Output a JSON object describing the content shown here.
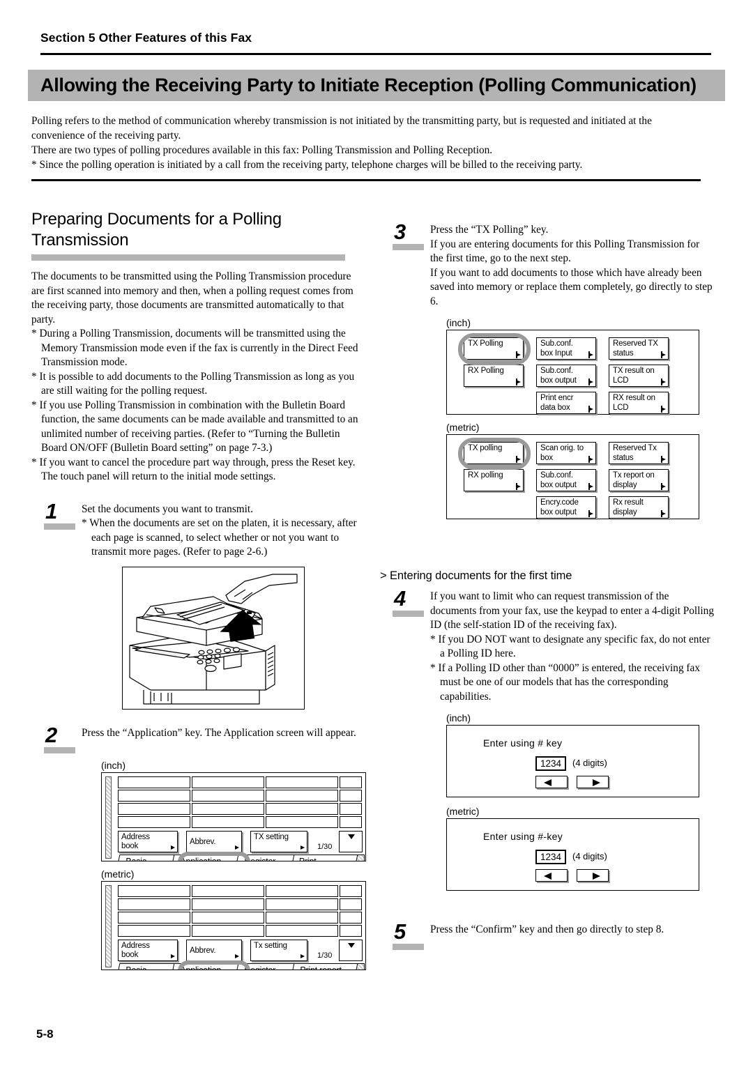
{
  "header": {
    "section": "Section 5  Other Features of this Fax",
    "title": "Allowing the Receiving Party to Initiate Reception  (Polling Communication)"
  },
  "intro": {
    "line1": "Polling refers to the method of communication whereby transmission is not initiated by the transmitting party, but is requested and initiated at the convenience of the receiving party.",
    "line2": "There are two types of polling procedures available in this fax: Polling Transmission and Polling Reception.",
    "line3": "* Since the polling operation is initiated by a call from the receiving party, telephone charges will be billed to the receiving party."
  },
  "left": {
    "heading": "Preparing Documents for a Polling Transmission",
    "body": {
      "para1": "The documents to be transmitted using the Polling Transmission procedure are first scanned into memory and then, when a polling request comes from the receiving party, those documents are transmitted automatically to that party.",
      "bullet1": "* During a Polling Transmission, documents will be transmitted using the Memory Transmission mode even if the fax is currently in the Direct Feed Transmission mode.",
      "bullet2": "* It is possible to add documents to the Polling Transmission as long as you are still waiting for the polling request.",
      "bullet3": "* If you use Polling Transmission in combination with the Bulletin Board function, the same documents can be made available and transmitted to an unlimited number of receiving parties. (Refer to “Turning the Bulletin Board ON/OFF (Bulletin Board setting” on page 7-3.)",
      "bullet4": "* If you want to cancel the procedure part way through, press the Reset key. The touch panel will return to the initial mode settings."
    },
    "step1": {
      "number": "1",
      "line1": "Set the documents you want to transmit.",
      "line2": "* When the documents are set on the platen, it is necessary, after each page is scanned, to select whether or not you want to transmit more pages. (Refer to page 2-6.)"
    },
    "step2": {
      "number": "2",
      "line1": "Press the “Application” key. The Application screen will appear."
    },
    "panel_inch_label": "(inch)",
    "panel_metric_label": "(metric)",
    "panel_inch": {
      "buttons": [
        "Address book",
        "Abbrev.",
        "TX setting"
      ],
      "page_indicator": "1/30",
      "tabs": [
        "Basic",
        "Application",
        "Register",
        "Print Report"
      ]
    },
    "panel_metric": {
      "buttons": [
        "Address book",
        "Abbrev.",
        "Tx setting"
      ],
      "page_indicator": "1/30",
      "tabs": [
        "Basic",
        "Application",
        "Register",
        "Print report"
      ]
    }
  },
  "right": {
    "step3": {
      "number": "3",
      "line1": "Press the “TX Polling” key.",
      "line2": "If you are entering documents for this Polling Transmission for the first time, go to the next step.",
      "line3": "If you want to add documents to those which have already been saved into memory or replace them completely, go directly to step 6."
    },
    "panel_inch_label": "(inch)",
    "panel_metric_label": "(metric)",
    "fkeys_inch": [
      [
        "TX Polling",
        "Sub.conf. box Input",
        "Reserved TX status"
      ],
      [
        "RX Polling",
        "Sub.conf. box output",
        "TX result on LCD"
      ],
      [
        "",
        "Print encr data box",
        "RX result on LCD"
      ]
    ],
    "fkeys_metric": [
      [
        "TX polling",
        "Scan orig. to box",
        "Reserved Tx status"
      ],
      [
        "RX polling",
        "Sub.conf. box output",
        "Tx report on display"
      ],
      [
        "",
        "Encry.code box output",
        "Rx result display"
      ]
    ],
    "marker": "> Entering documents for the first time",
    "step4": {
      "number": "4",
      "line1": "If you want to limit who can request transmission of the documents from your fax, use the keypad to enter a 4-digit Polling ID (the self-station ID of the receiving fax).",
      "line2": "* If you DO NOT want to designate any specific fax, do not enter a Polling ID here.",
      "line3": "* If a Polling ID other than “0000” is entered, the receiving fax must be one of our models that has the corresponding capabilities."
    },
    "id_panel_inch": {
      "title": "Enter using # key",
      "value": "1234",
      "note": "(4 digits)"
    },
    "id_panel_metric": {
      "title": "Enter using #-key",
      "value": "1234",
      "note": "(4 digits)"
    },
    "step5": {
      "number": "5",
      "line1": "Press the “Confirm” key and then go directly to step 8."
    }
  },
  "footer": {
    "page": "5-8"
  },
  "colors": {
    "banner": "#b3b3b3",
    "bar": "#b3b3b3",
    "highlight": "#9a9a9a"
  }
}
